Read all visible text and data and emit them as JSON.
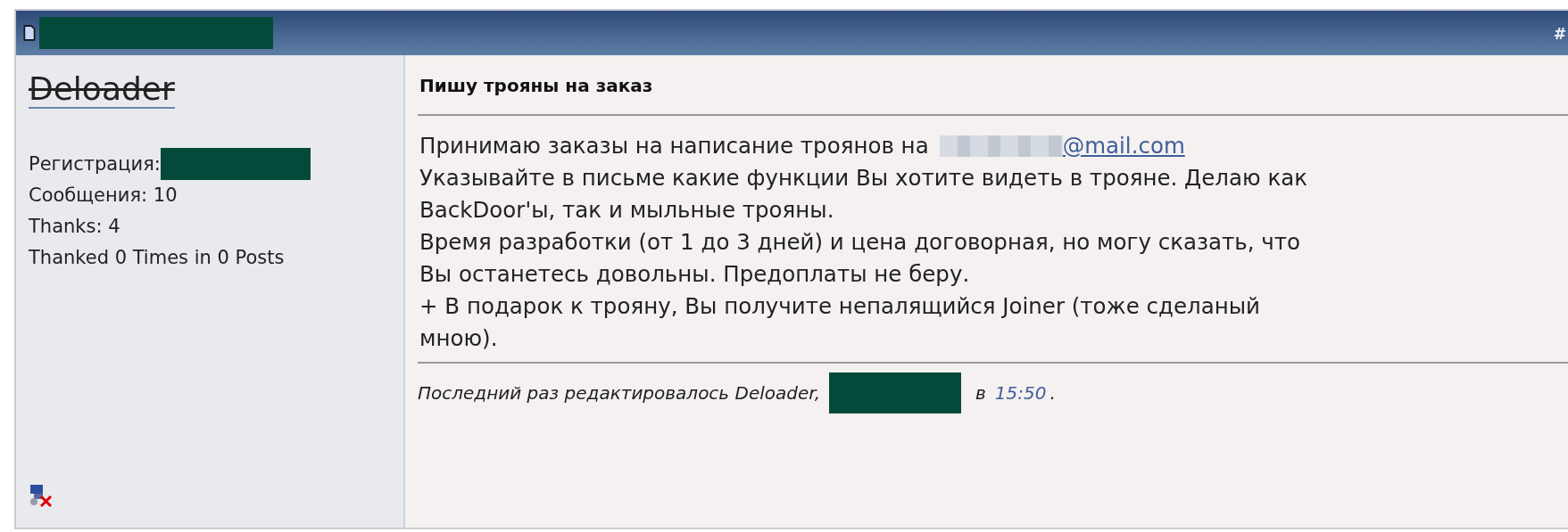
{
  "post": {
    "number": "#",
    "author": {
      "name": "Deloader",
      "stats": [
        {
          "label": "Регистрация:",
          "value_redacted": true
        },
        {
          "label": "Сообщения: 10",
          "value_redacted": false
        },
        {
          "label": "Thanks: 4",
          "value_redacted": false
        },
        {
          "label": "Thanked 0 Times in 0 Posts",
          "value_redacted": false
        }
      ],
      "online": false
    },
    "title": "Пишу трояны на заказ",
    "body_lines": [
      {
        "text": "Принимаю заказы на написание троянов на",
        "email": "@mail.com"
      },
      {
        "text": "Указывайте в письме какие функции Вы хотите видеть в трояне. Делаю как"
      },
      {
        "text": "BackDoor'ы, так и мыльные трояны."
      },
      {
        "text": "Время разработки (от 1 до 3 дней) и цена договорная, но могу сказать, что"
      },
      {
        "text": "Вы останетесь довольны. Предоплаты не беру."
      },
      {
        "text": "+ В подарок к трояну, Вы получите непалящийся Joiner (тоже сделаный"
      },
      {
        "text": "мною)."
      }
    ],
    "edit_note": {
      "text": "Последний раз редактировалось Deloader,",
      "at": "в",
      "time": "15:50",
      "period": "."
    }
  }
}
